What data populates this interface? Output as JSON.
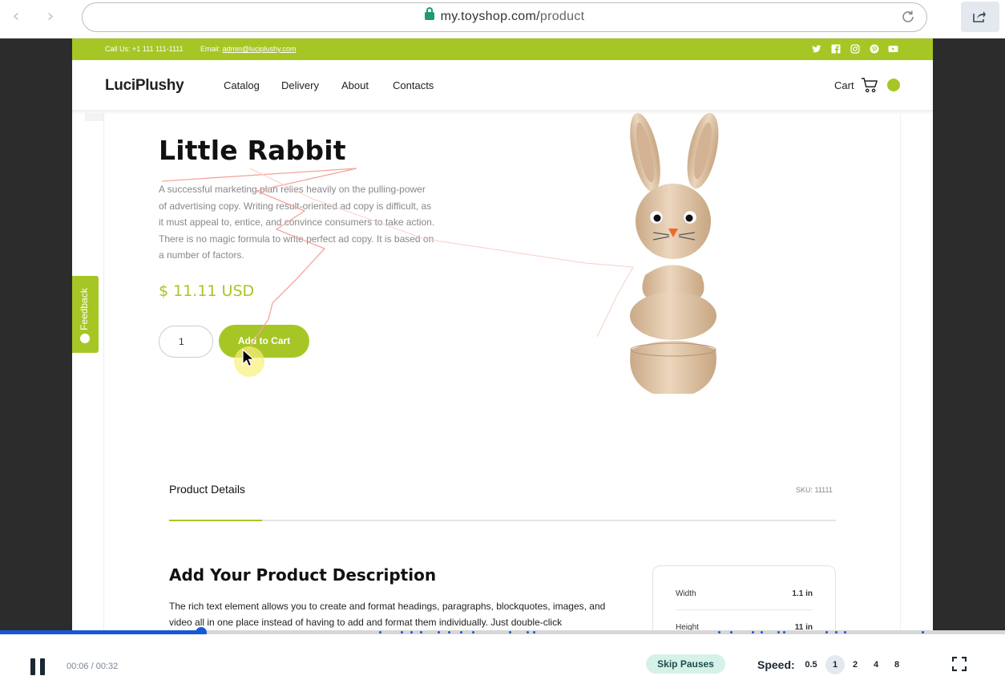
{
  "browser": {
    "url_host": "my.toyshop.com/",
    "url_path": "product",
    "icons": [
      "back-arrow-icon",
      "forward-arrow-icon",
      "lock-icon",
      "reload-icon",
      "share-icon"
    ]
  },
  "site": {
    "brand_color": "#a6c626",
    "topbar": {
      "call": "Call Us: +1 111 111-1111",
      "email_label": "Email: ",
      "email": "admin@luciplushy.com",
      "social_icons": [
        "twitter-icon",
        "facebook-icon",
        "instagram-icon",
        "pinterest-icon",
        "youtube-icon"
      ]
    },
    "logo": "LuciPlushy",
    "menu": [
      "Catalog",
      "Delivery",
      "About",
      "Contacts"
    ],
    "cart": "Cart",
    "feedback": "Feedback",
    "product": {
      "title": "Little Rabbit",
      "description": "A successful marketing plan relies heavily on the pulling-power of advertising copy. Writing result-oriented ad copy is difficult, as it must appeal to, entice, and convince consumers to take action. There is no magic formula to write perfect ad copy. It is based on a number of factors.",
      "price": "$ 11.11 USD",
      "quantity": "1",
      "add_to_cart": "Add to Cart"
    },
    "details": {
      "tab": "Product Details",
      "sku": "SKU: 11111",
      "heading": "Add Your Product Description",
      "body": "The rich text element allows you to create and format headings, paragraphs, blockquotes, images, and video all in one place instead of having to add and format them individually. Just double-click",
      "specs": [
        {
          "label": "Width",
          "value": "1.1 in"
        },
        {
          "label": "Height",
          "value": "11 in"
        }
      ]
    }
  },
  "player": {
    "progress": 0.2,
    "time": "00:06 / 00:32",
    "skip_pauses": "Skip Pauses",
    "speed_label": "Speed:",
    "speeds": [
      "0.5",
      "1",
      "2",
      "4",
      "8"
    ],
    "active_speed": "1",
    "icons": [
      "pause-icon",
      "fullscreen-icon"
    ]
  }
}
